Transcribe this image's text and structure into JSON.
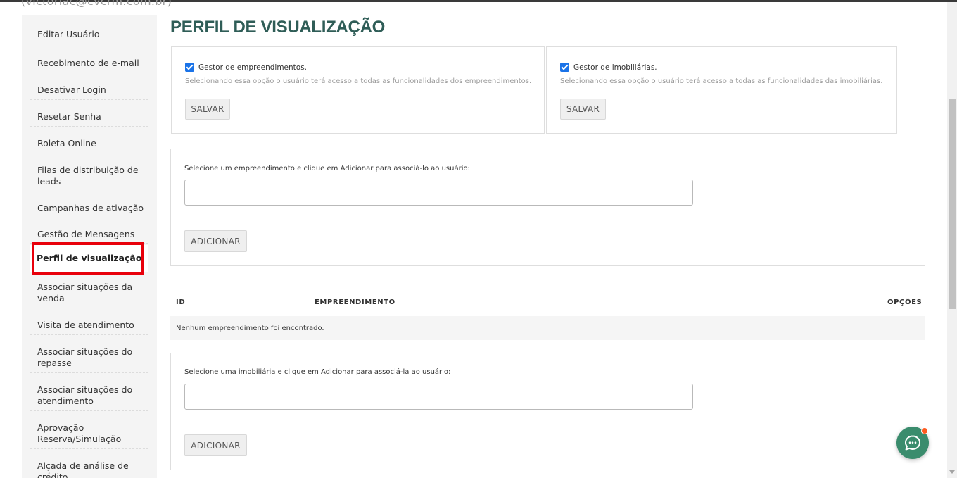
{
  "header": {
    "user_email_partial": "(victoriac@cvcrm.com.br)"
  },
  "sidebar": {
    "items": [
      {
        "label": "Editar Usuário",
        "active": false
      },
      {
        "label": "Recebimento de e-mail",
        "active": false
      },
      {
        "label": "Desativar Login",
        "active": false
      },
      {
        "label": "Resetar Senha",
        "active": false
      },
      {
        "label": "Roleta Online",
        "active": false
      },
      {
        "label": "Filas de distribuição de leads",
        "active": false
      },
      {
        "label": "Campanhas de ativação",
        "active": false
      },
      {
        "label": "Gestão de Mensagens",
        "active": false
      },
      {
        "label": "Perfil de visualização",
        "active": true
      },
      {
        "label": "Associar situações da venda",
        "active": false
      },
      {
        "label": "Visita de atendimento",
        "active": false
      },
      {
        "label": "Associar situações do repasse",
        "active": false
      },
      {
        "label": "Associar situações do atendimento",
        "active": false
      },
      {
        "label": "Aprovação Reserva/Simulação",
        "active": false
      },
      {
        "label": "Alçada de análise de crédito",
        "active": false
      }
    ]
  },
  "main": {
    "title": "PERFIL DE VISUALIZAÇÃO",
    "gestor_empreendimentos": {
      "checkbox_label": "Gestor de empreendimentos.",
      "checked": true,
      "hint": "Selecionando essa opção o usuário terá acesso a todas as funcionalidades dos empreendimentos.",
      "save_label": "SALVAR"
    },
    "gestor_imobiliarias": {
      "checkbox_label": "Gestor de imobiliárias.",
      "checked": true,
      "hint": "Selecionando essa opção o usuário terá acesso a todas as funcionalidades das imobiliárias.",
      "save_label": "SALVAR"
    },
    "add_empreendimento": {
      "label": "Selecione um empreendimento e clique em Adicionar para associá-lo ao usuário:",
      "input_value": "",
      "button_label": "ADICIONAR"
    },
    "table": {
      "columns": [
        "ID",
        "EMPREENDIMENTO",
        "OPÇÕES"
      ],
      "empty_message": "Nenhum empreendimento foi encontrado."
    },
    "add_imobiliaria": {
      "label": "Selecione uma imobiliária e clique em Adicionar para associá-la ao usuário:",
      "input_value": "",
      "button_label": "ADICIONAR"
    }
  },
  "colors": {
    "title": "#2f5d57",
    "highlight": "#e8000b",
    "checkbox": "#1a73e8",
    "chat_button": "#3a8c6d",
    "notification_dot": "#ff5a1f"
  },
  "icons": {
    "chat": "chat-bubble-icon",
    "check": "checkmark-icon"
  }
}
